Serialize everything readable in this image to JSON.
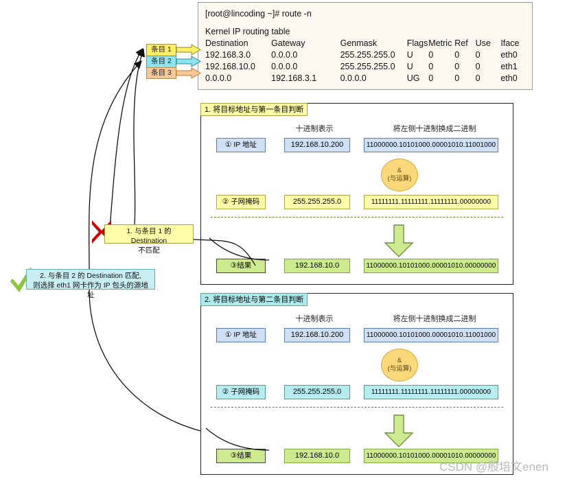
{
  "terminal": {
    "prompt_line": "[root@lincoding ~]# route -n",
    "table_caption": "Kernel IP routing table",
    "headers": [
      "Destination",
      "Gateway",
      "Genmask",
      "Flags",
      "Metric",
      "Ref",
      "Use",
      "Iface"
    ],
    "rows": [
      [
        "192.168.3.0",
        "0.0.0.0",
        "255.255.255.0",
        "U",
        "0",
        "0",
        "0",
        "eth0"
      ],
      [
        "192.168.10.0",
        "0.0.0.0",
        "255.255.255.0",
        "U",
        "0",
        "0",
        "0",
        "eth1"
      ],
      [
        "0.0.0.0",
        "192.168.3.1",
        "0.0.0.0",
        "UG",
        "0",
        "0",
        "0",
        "eth0"
      ]
    ],
    "bg_color": "#faf8ef"
  },
  "entries": [
    {
      "label": "条目 1",
      "color": "#ffef66"
    },
    {
      "label": "条目 2",
      "color": "#8ee3ec"
    },
    {
      "label": "条目 3",
      "color": "#f7c89a"
    }
  ],
  "panels": [
    {
      "title": "1. 将目标地址与第一条目判断",
      "title_color": "#ffffaa",
      "col_headers": {
        "decimal": "十进制表示",
        "binary": "将左侧十进制换成二进制"
      },
      "ip_row": {
        "label": "① IP 地址",
        "decimal": "192.168.10.200",
        "binary": "11000000.10101000.00001010.11001000"
      },
      "mask_row": {
        "label": "② 子网掩码",
        "decimal": "255.255.255.0",
        "binary": "11111111.11111111.11111111.00000000"
      },
      "result_row": {
        "label": "③结果",
        "decimal": "192.168.10.0",
        "binary": "11000000.10101000.00001010.00000000"
      },
      "operator": {
        "symbol": "&",
        "caption": "(与运算)",
        "color": "#fbd97a"
      },
      "mask_color": "#ffffaa"
    },
    {
      "title": "2. 将目标地址与第二条目判断",
      "title_color": "#aee9ec",
      "col_headers": {
        "decimal": "十进制表示",
        "binary": "将左侧十进制换成二进制"
      },
      "ip_row": {
        "label": "① IP 地址",
        "decimal": "192.168.10.200",
        "binary": "11000000.10101000.00001010.11001000"
      },
      "mask_row": {
        "label": "② 子网掩码",
        "decimal": "255.255.255.0",
        "binary": "11111111.11111111.11111111.00000000"
      },
      "result_row": {
        "label": "③结果",
        "decimal": "192.168.10.0",
        "binary": "11000000.10101000.00001010.00000000"
      },
      "operator": {
        "symbol": "&",
        "caption": "(与运算)",
        "color": "#fbd97a"
      },
      "mask_color": "#b6ecf0"
    }
  ],
  "callouts": {
    "mismatch": {
      "line1": "1. 与条目 1 的 Destination",
      "line2": "不匹配",
      "mark": "✗",
      "mark_color": "#cc0000",
      "bg_color": "#ffffaa"
    },
    "match": {
      "line1": "2. 与条目 2 的 Destination 匹配,",
      "line2": "则选择 eth1 网卡作为 IP 包头的源地址",
      "mark": "✓",
      "mark_color": "#8cc63f",
      "bg_color": "#c9eef2"
    }
  },
  "watermark": "CSDN @殷培文enen"
}
